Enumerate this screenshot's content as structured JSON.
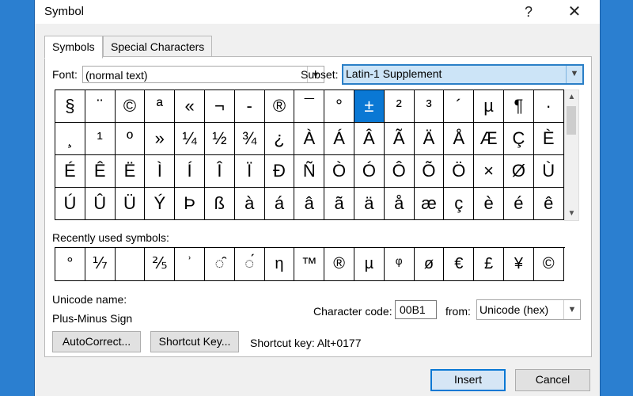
{
  "window": {
    "title": "Symbol",
    "help_glyph": "?",
    "close_glyph": "✕"
  },
  "tabs": [
    {
      "label": "Symbols"
    },
    {
      "label": "Special Characters"
    }
  ],
  "font": {
    "label": "Font:",
    "value": "(normal text)"
  },
  "subset": {
    "label": "Subset:",
    "value": "Latin-1 Supplement"
  },
  "symbol_rows": [
    [
      "§",
      "¨",
      "©",
      "ª",
      "«",
      "¬",
      "-",
      "®",
      "¯",
      "°",
      "±",
      "²",
      "³",
      "´",
      "µ",
      "¶",
      "·"
    ],
    [
      "¸",
      "¹",
      "º",
      "»",
      "¼",
      "½",
      "¾",
      "¿",
      "À",
      "Á",
      "Â",
      "Ã",
      "Ä",
      "Å",
      "Æ",
      "Ç",
      "È"
    ],
    [
      "É",
      "Ê",
      "Ë",
      "Ì",
      "Í",
      "Î",
      "Ï",
      "Ð",
      "Ñ",
      "Ò",
      "Ó",
      "Ô",
      "Õ",
      "Ö",
      "×",
      "Ø",
      "Ù"
    ],
    [
      "Ú",
      "Û",
      "Ü",
      "Ý",
      "Þ",
      "ß",
      "à",
      "á",
      "â",
      "ã",
      "ä",
      "å",
      "æ",
      "ç",
      "è",
      "é",
      "ê"
    ]
  ],
  "selected_symbol": "±",
  "recent": {
    "label": "Recently used symbols:",
    "symbols": [
      "°",
      "⅐",
      "",
      "⅖",
      "ʾ",
      "◌̑",
      "◌́",
      "η",
      "™",
      "®",
      "µ",
      "ᵠ",
      "ø",
      "€",
      "£",
      "¥",
      "©"
    ]
  },
  "unicode_name": {
    "label": "Unicode name:",
    "value": "Plus-Minus Sign"
  },
  "character_code": {
    "label": "Character code:",
    "value": "00B1"
  },
  "from": {
    "label": "from:",
    "value": "Unicode (hex)"
  },
  "buttons": {
    "autocorrect": "AutoCorrect...",
    "shortcut_key": "Shortcut Key...",
    "insert": "Insert",
    "cancel": "Cancel"
  },
  "shortcut_text": "Shortcut key: Alt+0177"
}
